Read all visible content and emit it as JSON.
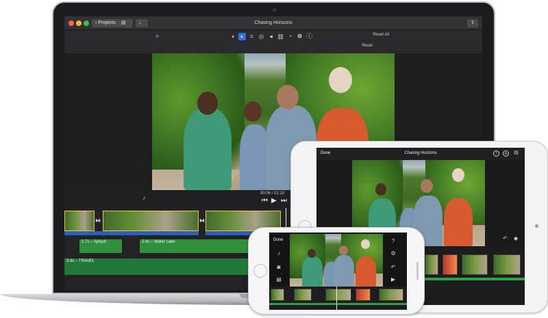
{
  "laptop": {
    "window_title": "Chasing Horizons",
    "projects_button": "Projects",
    "toolbar": {
      "reset_all": "Reset All",
      "reset": "Reset"
    },
    "timecode": "00:06 / 01:10",
    "audio_tracks": [
      {
        "label": "1.7s – Splash"
      },
      {
        "label": "2.4s – Water Lake"
      }
    ],
    "music_track": {
      "label": "9.8s – TRAVEL"
    }
  },
  "tablet": {
    "done_label": "Done",
    "title": "Chasing Horizons"
  },
  "phone": {
    "done_label": "Done"
  },
  "colors": {
    "accent_blue": "#2f5fb3",
    "audio_green": "#2f8f3c",
    "clip_border": "#f4c542"
  }
}
